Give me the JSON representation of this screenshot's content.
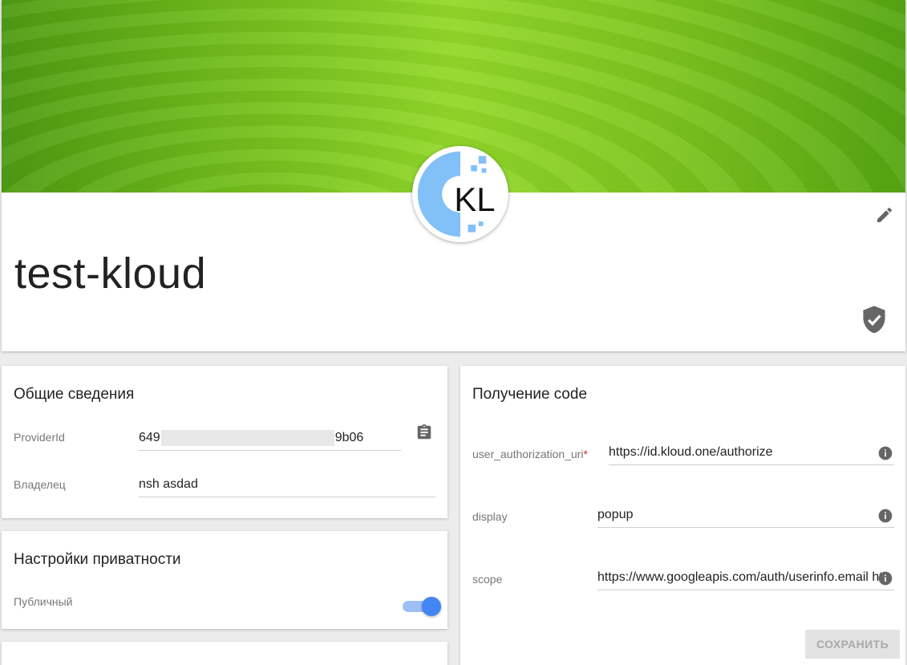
{
  "header": {
    "title": "test-kloud",
    "avatar_text": "KL",
    "icons": {
      "edit": "edit-icon",
      "verified": "verified-shield-icon"
    }
  },
  "general": {
    "title": "Общие сведения",
    "provider_id_label": "ProviderId",
    "provider_id_prefix": "649",
    "provider_id_suffix": "9b06",
    "owner_label": "Владелец",
    "owner_value": "nsh asdad",
    "copy_icon": "clipboard-icon"
  },
  "privacy": {
    "title": "Настройки приватности",
    "public_label": "Публичный",
    "public_enabled": true
  },
  "code": {
    "title": "Получение code",
    "fields": [
      {
        "label": "user_authorization_uri",
        "required": true,
        "value": "https://id.kloud.one/authorize"
      },
      {
        "label": "display",
        "required": false,
        "value": "popup"
      },
      {
        "label": "scope",
        "required": false,
        "value": "https://www.googleapis.com/auth/userinfo.email ht"
      }
    ],
    "required_mark": "*",
    "save_label": "СОХРАНИТЬ"
  },
  "colors": {
    "accent": "#4285f4",
    "banner": "#7cc41e",
    "avatar_blue": "#82c0f8"
  }
}
